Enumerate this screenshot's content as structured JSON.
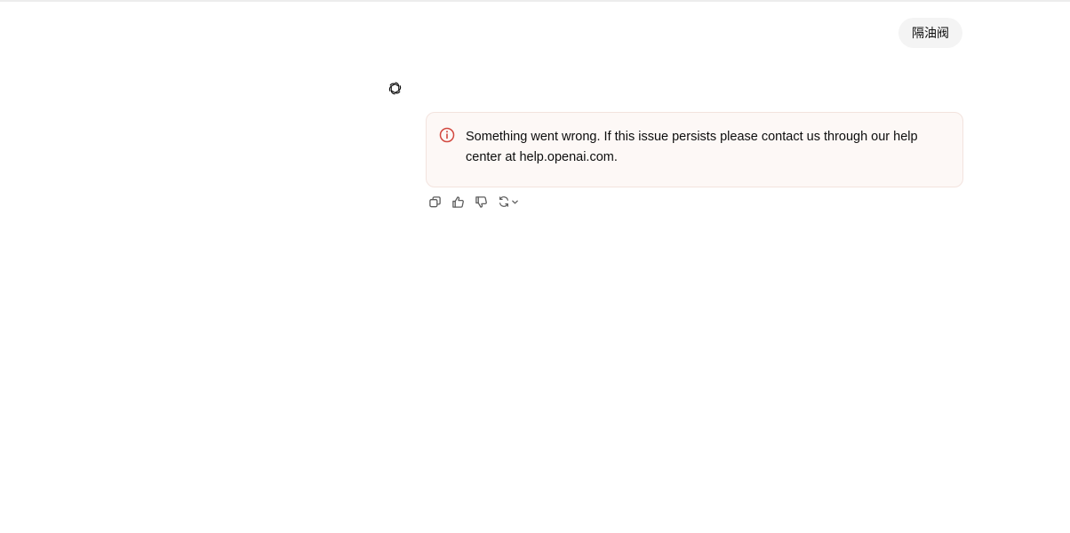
{
  "conversation": {
    "user_message": "隔油阀",
    "assistant": {
      "avatar_icon": "openai-logo-icon",
      "error": {
        "icon": "alert-circle-icon",
        "message": "Something went wrong. If this issue persists please contact us through our help center at help.openai.com.",
        "accent_color": "#d2483f",
        "background_color": "#fdf8f6"
      },
      "actions": [
        {
          "icon": "copy-icon"
        },
        {
          "icon": "thumbs-up-icon"
        },
        {
          "icon": "thumbs-down-icon"
        },
        {
          "icon": "regenerate-icon"
        }
      ]
    }
  }
}
